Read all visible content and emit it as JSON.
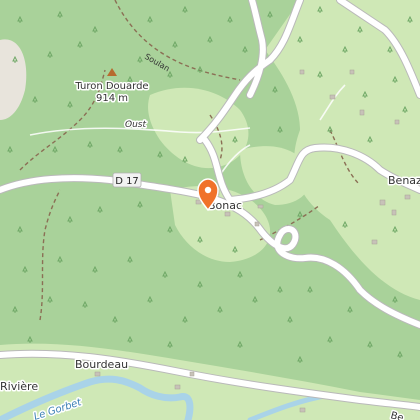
{
  "map": {
    "colors": {
      "forest": "#a9d29a",
      "meadow": "#cfe8b6",
      "road": "#ffffff",
      "road_casing": "#b9b9b9",
      "river": "#a9d3e8",
      "trail": "#8b6f55",
      "marker": "#f0722a",
      "peak": "#b76b2f"
    },
    "labels": {
      "peak_name": "Turon Douarde",
      "peak_elevation": "914 m",
      "stream_oust": "Oust",
      "trail_soulan": "Soulan",
      "place_bonac": "Bonac",
      "place_benaz": "Benaz",
      "place_bourdeau": "Bourdeau",
      "place_riviere": "Rivière",
      "river_le_gorbet": "Le Gorbet",
      "road_ref": "D 17",
      "cut_label_bottom_right": "Be"
    },
    "icons": {
      "marker": "map-pin-icon",
      "peak": "peak-triangle-icon",
      "trees": "tree-symbol-icon"
    }
  }
}
